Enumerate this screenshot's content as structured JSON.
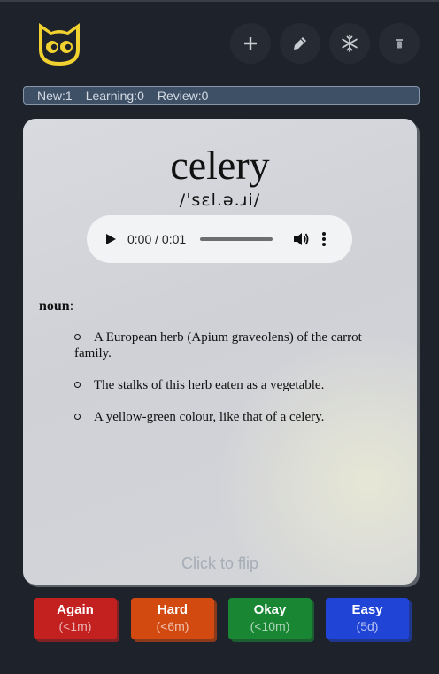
{
  "toolbar": {
    "buttons": [
      {
        "name": "add-button",
        "icon": "plus-icon"
      },
      {
        "name": "edit-button",
        "icon": "pencil-icon"
      },
      {
        "name": "settings-button",
        "icon": "snowflake-icon"
      },
      {
        "name": "delete-button",
        "icon": "trash-icon"
      }
    ]
  },
  "stats": {
    "new": "New:1",
    "learning": "Learning:0",
    "review": "Review:0"
  },
  "card": {
    "word": "celery",
    "ipa": "/ˈsɛl.ə.ɹi/",
    "audio": {
      "time": "0:00 / 0:01",
      "progress": 0
    },
    "part_of_speech": "noun",
    "definitions": [
      "A European herb (Apium graveolens) of the carrot family.",
      "The stalks of this herb eaten as a vegetable.",
      "A yellow-green colour, like that of a celery."
    ],
    "flip_hint": "Click to flip"
  },
  "answers": [
    {
      "label": "Again",
      "interval": "(<1m)",
      "color": "#c32020"
    },
    {
      "label": "Hard",
      "interval": "(<6m)",
      "color": "#d24a10"
    },
    {
      "label": "Okay",
      "interval": "(<10m)",
      "color": "#198634"
    },
    {
      "label": "Easy",
      "interval": "(5d)",
      "color": "#2045d6"
    }
  ],
  "colors": {
    "background": "#1e232b",
    "stats_bar": "#3e5066",
    "logo": "#f1d130"
  }
}
